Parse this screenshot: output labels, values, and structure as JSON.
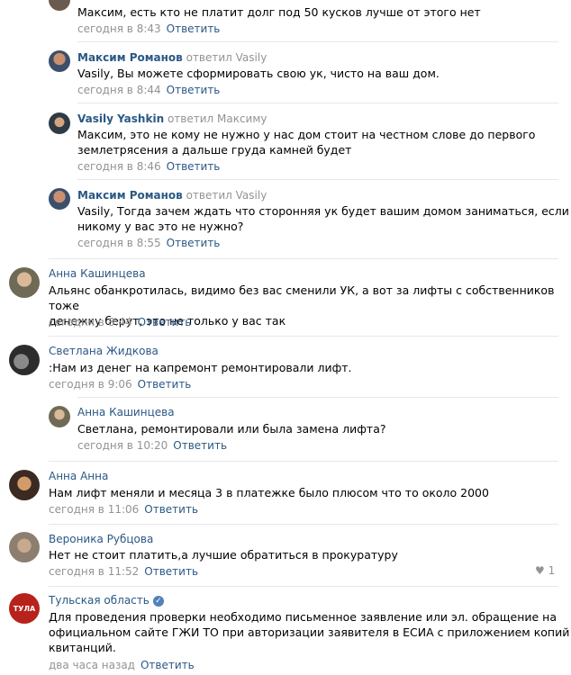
{
  "comments": [
    {
      "text": "Максим, есть кто не платит долг под 50 кусков лучше от этого нет",
      "time": "сегодня в 8:43",
      "reply_label": "Ответить"
    },
    {
      "author": "Максим Романов",
      "replied_to": "ответил Vasily",
      "text": "Vasily, Вы можете сформировать свою ук, чисто на ваш дом.",
      "time": "сегодня в 8:44",
      "reply_label": "Ответить"
    },
    {
      "author": "Vasily Yashkin",
      "replied_to": "ответил Максиму",
      "text": "Максим, это не кому не нужно у нас дом стоит на честном слове до первого\nземлетрясения а дальше груда камней будет",
      "time": "сегодня в 8:46",
      "reply_label": "Ответить"
    },
    {
      "author": "Максим Романов",
      "replied_to": "ответил Vasily",
      "text": "Vasily, Тогда зачем ждать что сторонняя ук будет вашим домом заниматься, если\nникому у вас это не нужно?",
      "time": "сегодня в 8:55",
      "reply_label": "Ответить"
    },
    {
      "author": "Анна Кашинцева",
      "text": "Альянс обанкротилась, видимо без вас сменили УК, а вот за лифты с собственников тоже\nденежку берут, это не только у вас так",
      "time": "сегодня в 8:44",
      "reply_label": "Ответить"
    },
    {
      "author": "Светлана Жидкова",
      "text": ":Нам из денег на капремонт ремонтировали лифт.",
      "time": "сегодня в 9:06",
      "reply_label": "Ответить"
    },
    {
      "author": "Анна Кашинцева",
      "text": "Светлана, ремонтировали или была замена лифта?",
      "time": "сегодня в 10:20",
      "reply_label": "Ответить"
    },
    {
      "author": "Анна Анна",
      "text": "Нам лифт меняли и месяца 3 в платежке было плюсом что то около 2000",
      "time": "сегодня в 11:06",
      "reply_label": "Ответить"
    },
    {
      "author": "Вероника Рубцова",
      "text": "Нет не стоит платить,а лучшие обратиться в прокуратуру",
      "time": "сегодня в 11:52",
      "reply_label": "Ответить",
      "likes": "1"
    },
    {
      "author": "Тульская область",
      "text": "Для проведения проверки необходимо письменное заявление или эл. обращение на\nофициальном сайте ГЖИ ТО при авторизации заявителя в ЕСИА с приложением копий\nквитанций.",
      "time": "два часа назад",
      "reply_label": "Ответить",
      "avatar_text": "ТУЛА"
    }
  ],
  "colors": {
    "link": "#2a5885",
    "muted": "#939393",
    "divider": "#e7e8ec",
    "verified": "#5181b8"
  }
}
